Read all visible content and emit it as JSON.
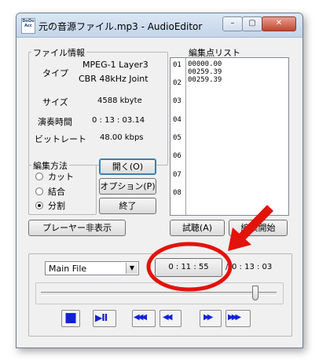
{
  "window": {
    "title": "元の音源ファイル.mp3 - AudioEditor",
    "app_icon_text": "DoDo\nAcc",
    "min_glyph": "–",
    "max_glyph": "▢",
    "close_glyph": "✕"
  },
  "file_info": {
    "legend": "ファイル情報",
    "type_label": "タイプ",
    "type_value_1": "MPEG-1 Layer3",
    "type_value_2": "CBR 48kHz Joint",
    "size_label": "サイズ",
    "size_value": "4588 kbyte",
    "duration_label": "演奏時間",
    "duration_value": "0 : 13 : 03.14",
    "bitrate_label": "ビットレート",
    "bitrate_value": "48.00 kbps"
  },
  "edit_list": {
    "label": "編集点リスト",
    "row_numbers": [
      "01",
      "02",
      "03",
      "04",
      "05",
      "06",
      "07",
      "08"
    ],
    "entries": [
      "00000.00",
      "00259.39",
      "00259.39"
    ]
  },
  "edit_method": {
    "legend": "編集方法",
    "options": [
      "カット",
      "結合",
      "分割"
    ],
    "selected_index": 2
  },
  "buttons": {
    "open": "開く(O)",
    "options": "オプション(P)",
    "exit": "終了",
    "hide_player": "プレーヤー非表示",
    "preview": "試聴(A)",
    "start_edit": "編集開始"
  },
  "player": {
    "file_select": "Main File",
    "current_time": "0 : 11 : 55",
    "separator": "/",
    "total_time": "0 : 13 : 03",
    "seek_position": 0.91,
    "controls": {
      "stop": "■",
      "play_pause": "▶II",
      "rewind_fast": "◀◀◀",
      "rewind": "◀◀",
      "forward": "▶▶",
      "forward_fast": "▶▶▶"
    }
  },
  "annotation": {
    "arrow_color": "#e3120b",
    "ring_color": "#e3120b"
  }
}
